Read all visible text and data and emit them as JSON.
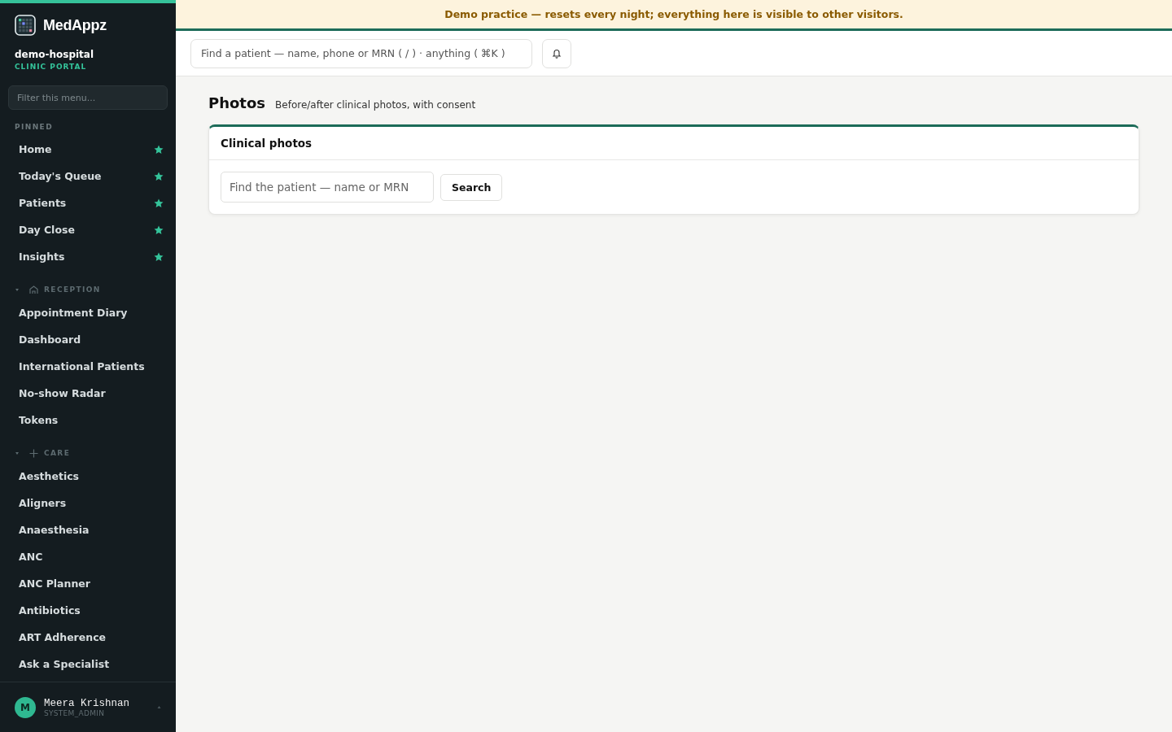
{
  "banner": "Demo practice — resets every night; everything here is visible to other visitors.",
  "sidebar": {
    "brand": "MedAppz",
    "org": "demo-hospital",
    "portal": "CLINIC PORTAL",
    "filter": {
      "placeholder": "Filter this menu..."
    },
    "pinned": {
      "label": "PINNED",
      "items": [
        {
          "label": "Home",
          "starred": true
        },
        {
          "label": "Today's Queue",
          "starred": true
        },
        {
          "label": "Patients",
          "starred": true
        },
        {
          "label": "Day Close",
          "starred": true
        },
        {
          "label": "Insights",
          "starred": true
        }
      ]
    },
    "groups": [
      {
        "label": "RECEPTION",
        "kind": "home",
        "expanded": true,
        "items": [
          "Appointment Diary",
          "Dashboard",
          "International Patients",
          "No-show Radar",
          "Tokens"
        ]
      },
      {
        "label": "CARE",
        "kind": "plus",
        "expanded": true,
        "items": [
          "Aesthetics",
          "Aligners",
          "Anaesthesia",
          "ANC",
          "ANC Planner",
          "Antibiotics",
          "ART Adherence",
          "Ask a Specialist"
        ]
      }
    ],
    "user": {
      "initial": "M",
      "name": "Meera Krishnan",
      "role": "SYSTEM_ADMIN"
    }
  },
  "topbar": {
    "search": {
      "placeholder": "Find a patient — name, phone or MRN ( / ) · anything ( ⌘K )"
    }
  },
  "page": {
    "title": "Photos",
    "subtitle": "Before/after clinical photos, with consent",
    "card": {
      "title": "Clinical photos",
      "search": {
        "placeholder": "Find the patient — name or MRN"
      },
      "button": "Search"
    }
  }
}
